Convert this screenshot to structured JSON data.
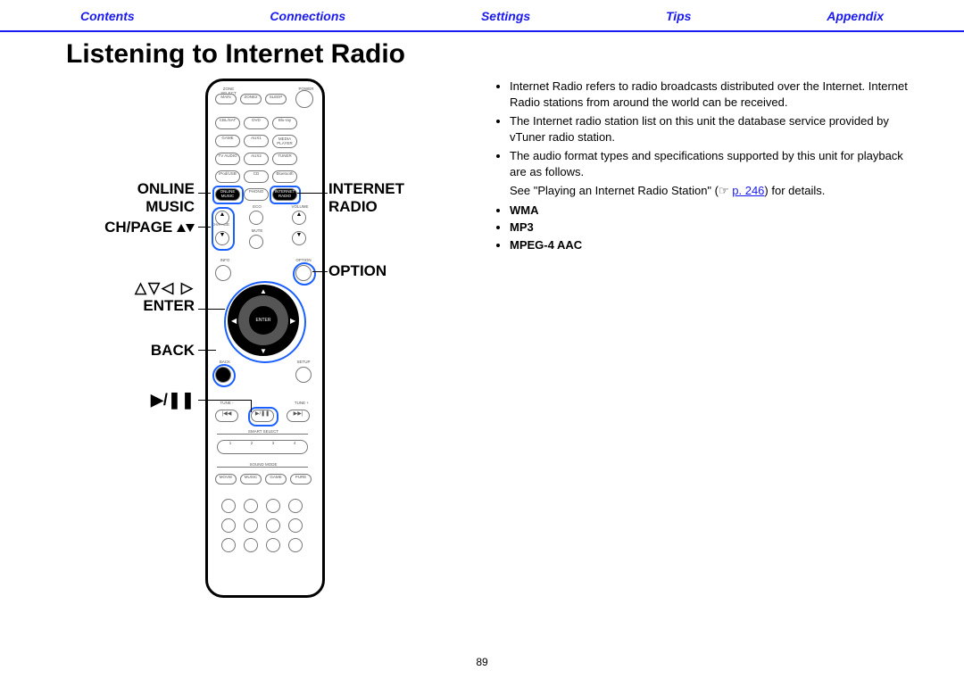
{
  "nav": {
    "contents": "Contents",
    "connections": "Connections",
    "settings": "Settings",
    "tips": "Tips",
    "appendix": "Appendix"
  },
  "title": "Listening to Internet Radio",
  "callouts": {
    "online_music_l1": "ONLINE",
    "online_music_l2": "MUSIC",
    "ch_page": "CH/PAGE",
    "enter": "ENTER",
    "back": "BACK",
    "internet_radio_l1": "INTERNET",
    "internet_radio_l2": "RADIO",
    "option": "OPTION",
    "arrows": "△▽◁ ▷",
    "play_pause": "▶/❚❚"
  },
  "bullets": {
    "b1": "Internet Radio refers to radio broadcasts distributed over the Internet. Internet Radio stations from around the world can be received.",
    "b2": "The Internet radio station list on this unit the database service provided by vTuner radio station.",
    "b3": "The audio format types and specifications supported by this unit for playback are as follows."
  },
  "see_prefix": "See \"Playing an Internet Radio Station\" (",
  "see_icon": "☞",
  "see_link": "p. 246",
  "see_suffix": ") for details.",
  "formats": {
    "f1": "WMA",
    "f2": "MP3",
    "f3": "MPEG-4 AAC"
  },
  "page_number": "89",
  "remote": {
    "zone_select": "ZONE SELECT",
    "power": "POWER",
    "main": "MAIN",
    "zone2": "ZONE2",
    "sleep": "SLEEP",
    "cbl_sat": "CBL/SAT",
    "dvd": "DVD",
    "bluray": "Blu-ray",
    "game": "GAME",
    "aux1": "AUX1",
    "media_player": "MEDIA PLAYER",
    "tv_audio": "TV AUDIO",
    "aux2": "AUX2",
    "tuner": "TUNER",
    "ipod_usb": "iPod/USB",
    "cd": "CD",
    "bluetooth": "Bluetooth",
    "online_music": "ONLINE MUSIC",
    "phono": "PHONO",
    "internet_radio": "INTERNET RADIO",
    "ch_page": "CH/PAGE",
    "eco": "ECO",
    "mute": "MUTE",
    "volume": "VOLUME",
    "info": "INFO",
    "option": "OPTION",
    "enter": "ENTER",
    "back": "BACK",
    "setup": "SETUP",
    "tune_minus": "TUNE -",
    "tune_plus": "TUNE +",
    "smart_select": "SMART SELECT",
    "sound_mode": "SOUND MODE",
    "movie": "MOVIE",
    "music": "MUSIC",
    "game_mode": "GAME",
    "pure": "PURE"
  }
}
